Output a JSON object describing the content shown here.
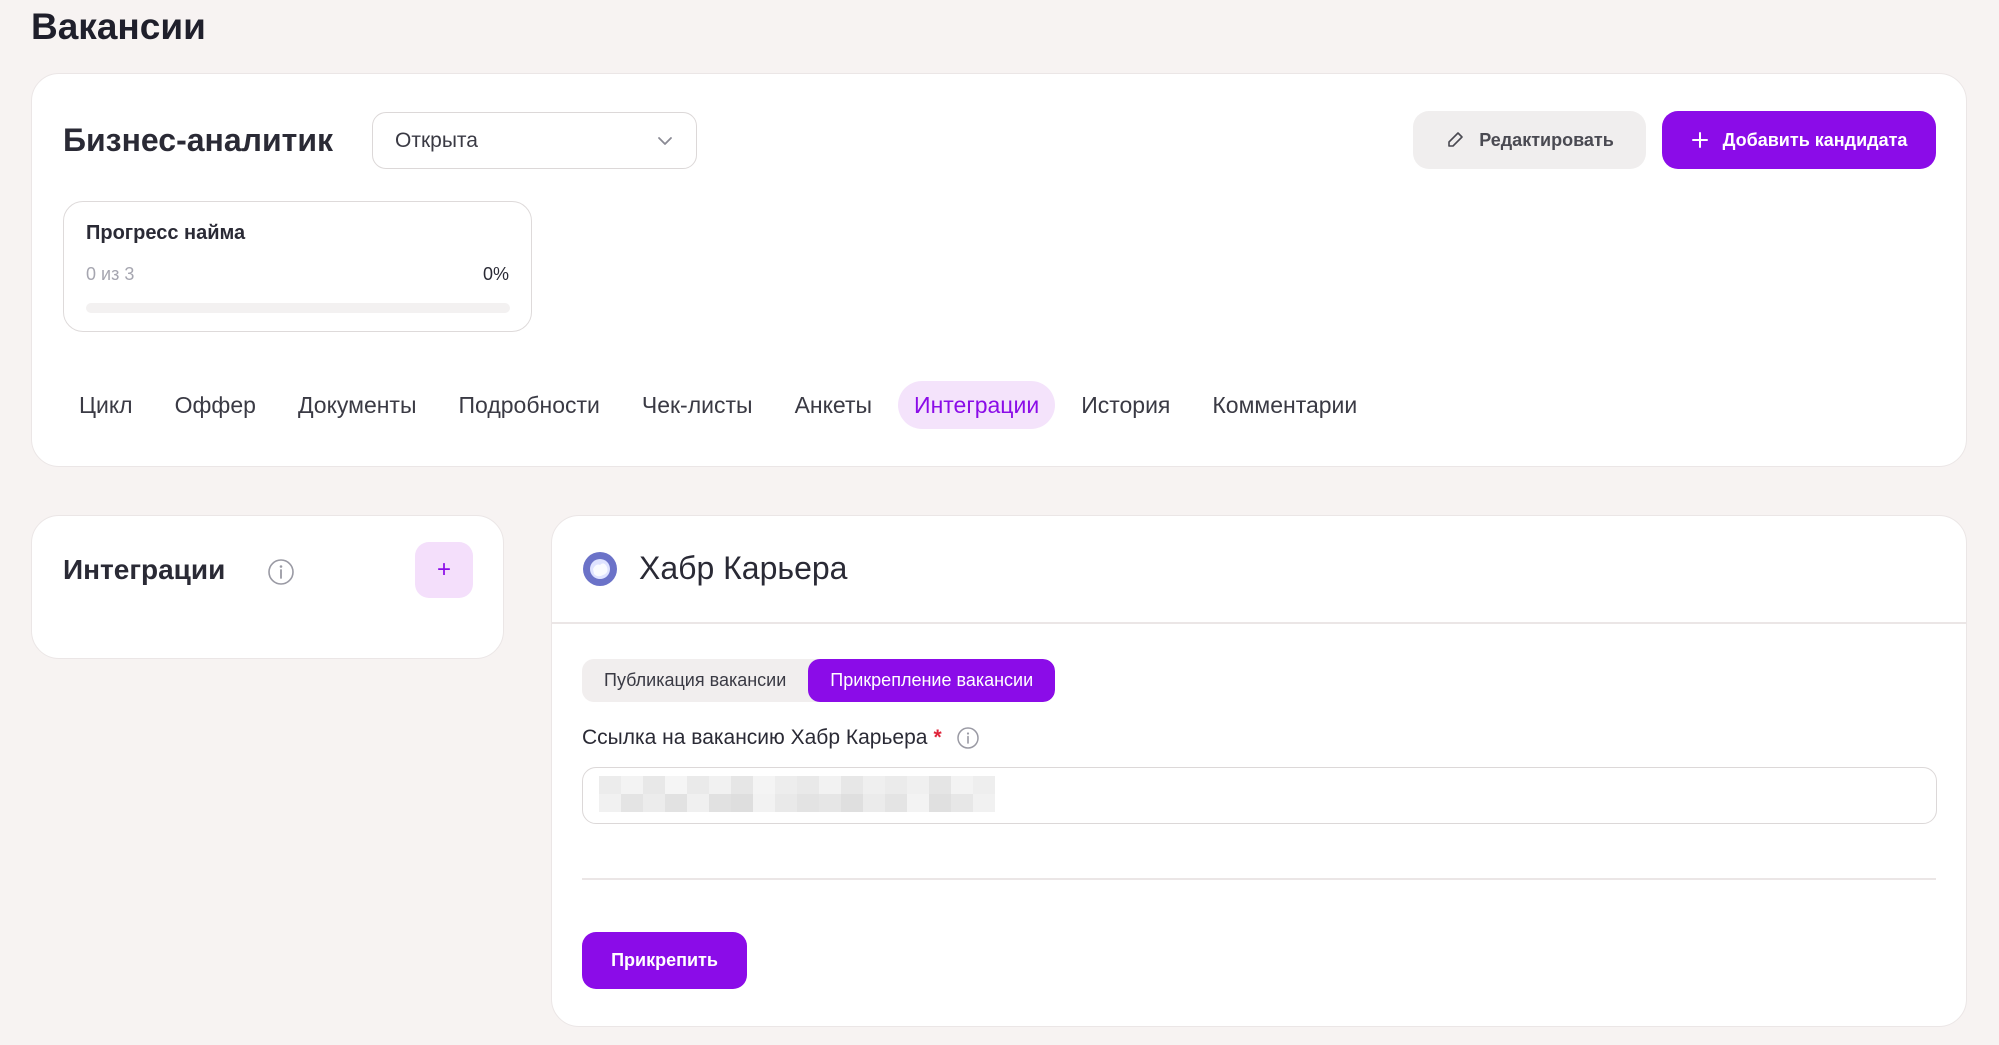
{
  "page_title": "Вакансии",
  "vacancy": {
    "title": "Бизнес-аналитик",
    "status": "Открыта",
    "edit_label": "Редактировать",
    "add_candidate_label": "Добавить кандидата"
  },
  "progress": {
    "label": "Прогресс найма",
    "count": "0 из 3",
    "percent_text": "0%",
    "value": 0
  },
  "tabs": [
    {
      "label": "Цикл",
      "active": false
    },
    {
      "label": "Оффер",
      "active": false
    },
    {
      "label": "Документы",
      "active": false
    },
    {
      "label": "Подробности",
      "active": false
    },
    {
      "label": "Чек-листы",
      "active": false
    },
    {
      "label": "Анкеты",
      "active": false
    },
    {
      "label": "Интеграции",
      "active": true
    },
    {
      "label": "История",
      "active": false
    },
    {
      "label": "Комментарии",
      "active": false
    }
  ],
  "integrations_panel": {
    "title": "Интеграции",
    "add_symbol": "+"
  },
  "habr": {
    "title": "Хабр Карьера",
    "modes": [
      {
        "label": "Публикация вакансии",
        "active": false
      },
      {
        "label": "Прикрепление вакансии",
        "active": true
      }
    ],
    "field_label": "Ссылка на вакансию Хабр Карьера",
    "required_mark": "*",
    "url_value": "",
    "attach_label": "Прикрепить"
  },
  "colors": {
    "accent": "#8b0ce8",
    "accent_light": "#f4e3fb",
    "background": "#f7f3f2",
    "required": "#e0243a"
  },
  "icons": [
    "chevron-down-icon",
    "pencil-icon",
    "plus-icon",
    "info-icon",
    "habr-logo-icon"
  ]
}
